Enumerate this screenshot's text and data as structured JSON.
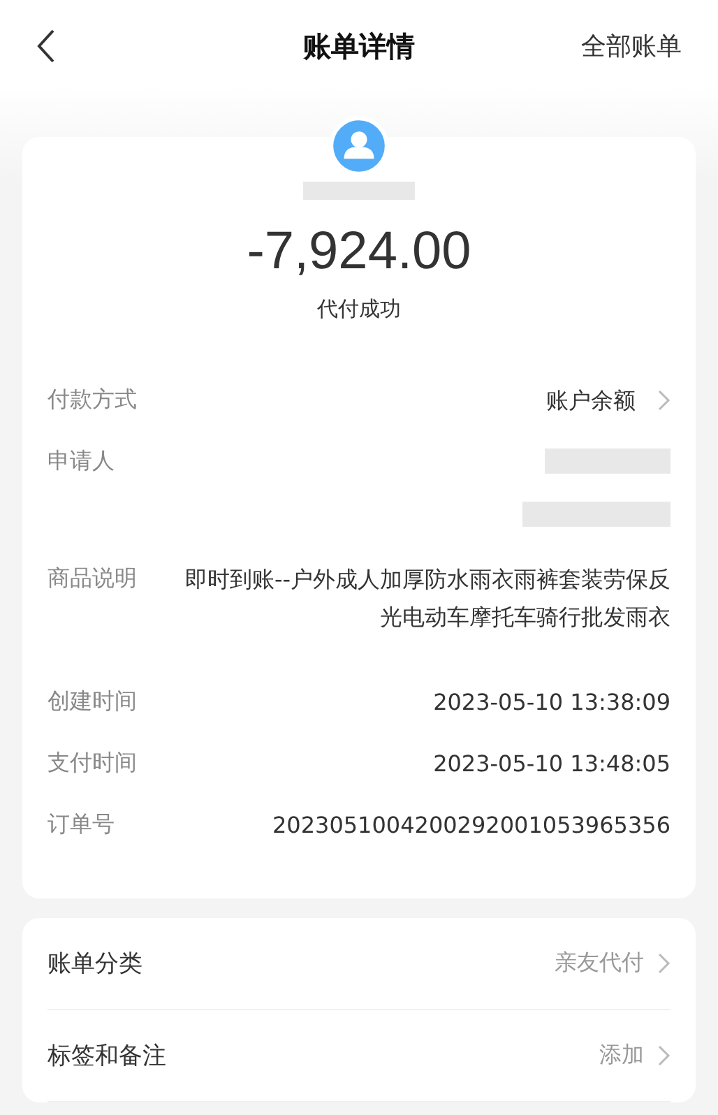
{
  "nav": {
    "title": "账单详情",
    "action": "全部账单"
  },
  "summary": {
    "amount": "-7,924.00",
    "status": "代付成功"
  },
  "details": [
    {
      "kind": "text",
      "label": "付款方式",
      "value": "账户余额",
      "link": true
    },
    {
      "kind": "redacted",
      "label": "申请人"
    },
    {
      "kind": "text",
      "label": "商品说明",
      "value": "即时到账--户外成人加厚防水雨衣雨裤套装劳保反光电动车摩托车骑行批发雨衣",
      "link": false
    },
    {
      "kind": "text",
      "label": "创建时间",
      "value": "2023-05-10 13:38:09",
      "link": false
    },
    {
      "kind": "text",
      "label": "支付时间",
      "value": "2023-05-10 13:48:05",
      "link": false
    },
    {
      "kind": "text",
      "label": "订单号",
      "value": "2023051004200292001053965356",
      "link": false
    }
  ],
  "options": [
    {
      "label": "账单分类",
      "value": "亲友代付"
    },
    {
      "label": "标签和备注",
      "value": "添加"
    }
  ]
}
